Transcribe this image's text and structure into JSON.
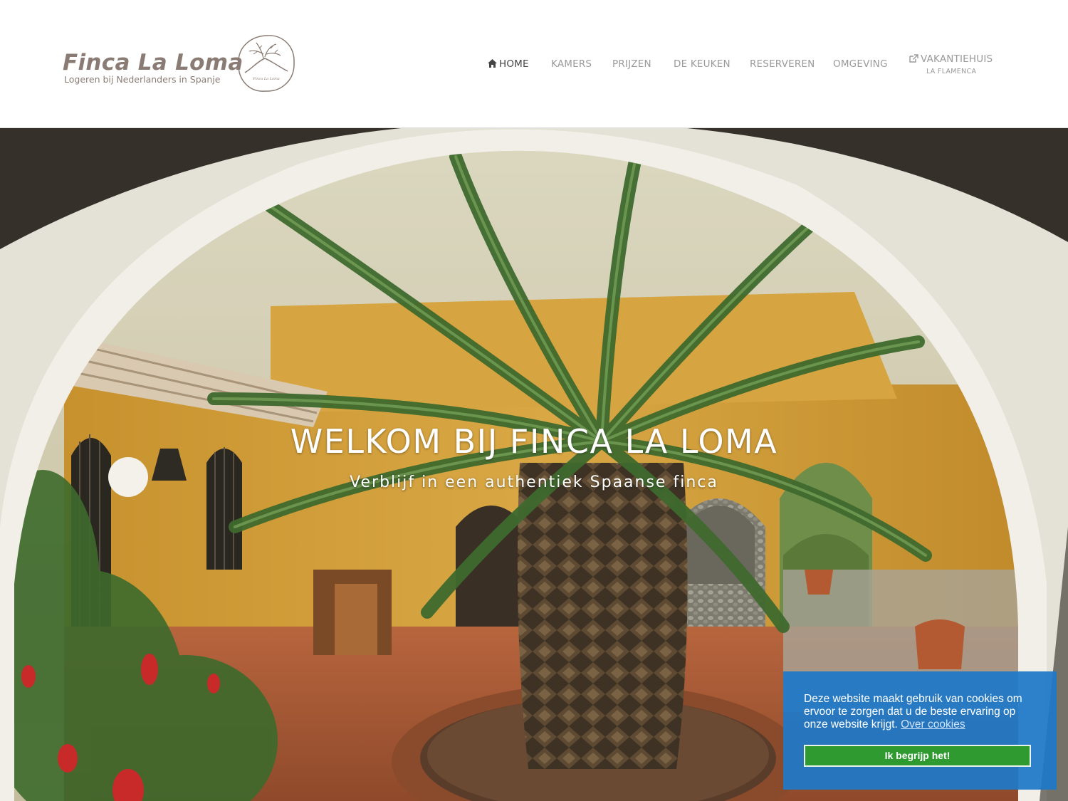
{
  "brand": {
    "title": "Finca La Loma",
    "subtitle": "Logeren bij Nederlanders in Spanje",
    "logo_text": "Finca La Loma"
  },
  "nav": {
    "items": [
      {
        "label": "HOME",
        "icon": "home-icon",
        "active": true
      },
      {
        "label": "KAMERS"
      },
      {
        "label": "PRIJZEN"
      },
      {
        "label": "DE KEUKEN"
      },
      {
        "label": "RESERVEREN"
      },
      {
        "label": "OMGEVING"
      },
      {
        "label": "VAKANTIEHUIS",
        "icon": "external-link-icon",
        "sublabel": "LA FLAMENCA"
      }
    ]
  },
  "hero": {
    "title": "WELKOM BIJ FINCA LA LOMA",
    "subtitle": "Verblijf in een authentiek Spaanse finca"
  },
  "cookie": {
    "text": "Deze website maakt gebruik van cookies om ervoor te zorgen dat u de beste ervaring op onze website krijgt.",
    "link": "Over cookies",
    "button": "Ik begrijp het!"
  },
  "colors": {
    "brand": "#8a7c74",
    "cookie_bg": "#1e78c8",
    "cookie_button": "#2e9a30"
  }
}
